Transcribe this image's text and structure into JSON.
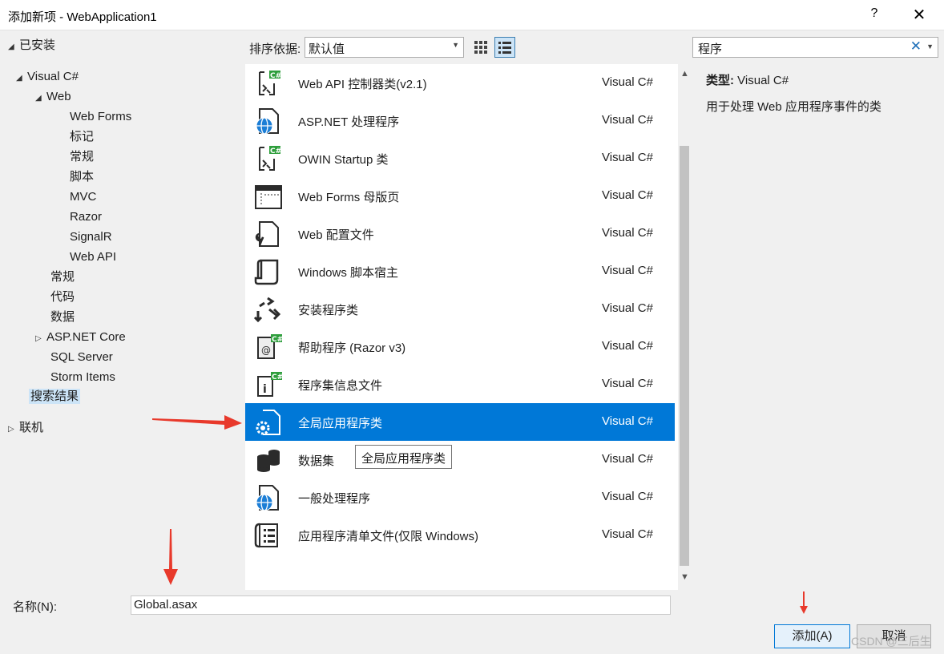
{
  "window": {
    "title": "添加新项 - WebApplication1",
    "help": "?",
    "close": "✕"
  },
  "tree": {
    "installed": "已安装",
    "visual_csharp": "Visual C#",
    "web": "Web",
    "web_children": [
      "Web Forms",
      "标记",
      "常规",
      "脚本",
      "MVC",
      "Razor",
      "SignalR",
      "Web API"
    ],
    "csharp_children": [
      "常规",
      "代码",
      "数据"
    ],
    "aspnet_core": "ASP.NET Core",
    "sql_server": "SQL Server",
    "storm_items": "Storm Items",
    "search_results": "搜索结果",
    "online": "联机"
  },
  "toolbar": {
    "sort_label": "排序依据:",
    "sort_value": "默认值"
  },
  "search": {
    "value": "程序",
    "clear": "✕"
  },
  "items": [
    {
      "name": "Web API 控制器类(v2.1)",
      "lang": "Visual C#",
      "icon": "csharp-class-icon"
    },
    {
      "name": "ASP.NET 处理程序",
      "lang": "Visual C#",
      "icon": "globe-handler-icon"
    },
    {
      "name": "OWIN Startup 类",
      "lang": "Visual C#",
      "icon": "csharp-class-icon"
    },
    {
      "name": "Web Forms 母版页",
      "lang": "Visual C#",
      "icon": "master-page-icon"
    },
    {
      "name": "Web 配置文件",
      "lang": "Visual C#",
      "icon": "config-file-icon"
    },
    {
      "name": "Windows 脚本宿主",
      "lang": "Visual C#",
      "icon": "script-host-icon"
    },
    {
      "name": "安装程序类",
      "lang": "Visual C#",
      "icon": "installer-icon"
    },
    {
      "name": "帮助程序 (Razor v3)",
      "lang": "Visual C#",
      "icon": "razor-helper-icon"
    },
    {
      "name": "程序集信息文件",
      "lang": "Visual C#",
      "icon": "assembly-info-icon"
    },
    {
      "name": "全局应用程序类",
      "lang": "Visual C#",
      "icon": "global-app-icon"
    },
    {
      "name": "数据集",
      "lang": "Visual C#",
      "icon": "dataset-icon"
    },
    {
      "name": "一般处理程序",
      "lang": "Visual C#",
      "icon": "globe-handler-icon"
    },
    {
      "name": "应用程序清单文件(仅限 Windows)",
      "lang": "Visual C#",
      "icon": "manifest-icon"
    }
  ],
  "tooltip": "全局应用程序类",
  "detail": {
    "type_label": "类型:",
    "type_value": "Visual C#",
    "description": "用于处理 Web 应用程序事件的类"
  },
  "footer": {
    "name_label": "名称(N):",
    "name_value": "Global.asax",
    "add_button": "添加(A)",
    "cancel_button": "取消"
  },
  "watermark": "CSDN @三后生",
  "colors": {
    "selection": "#0078d7",
    "arrow": "#e8392b"
  }
}
